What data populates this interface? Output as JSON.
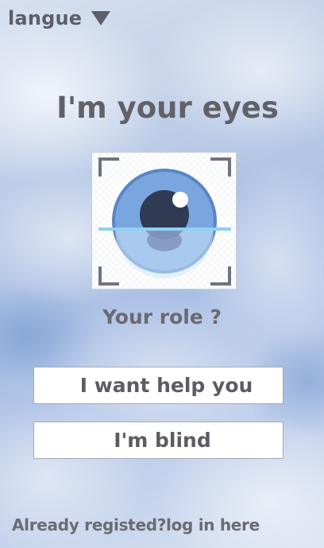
{
  "language_selector": {
    "label": "langue",
    "icon": "caret-down-icon"
  },
  "header": {
    "title": "I'm your eyes"
  },
  "logo": {
    "icon": "eye-scan-icon",
    "colors": {
      "iris": "#7aa6e0",
      "iris_ring": "#5b86c4",
      "pupil": "#2f3b52",
      "scan_line": "#8fd0f0",
      "lower_tint": "#cfe8fa",
      "frame_corners": "#6c7482"
    }
  },
  "role": {
    "prompt": "Your role ?",
    "options": [
      {
        "label": "I want help you"
      },
      {
        "label": "I'm blind"
      }
    ]
  },
  "footer": {
    "login_link": "Already registed?log in here"
  }
}
